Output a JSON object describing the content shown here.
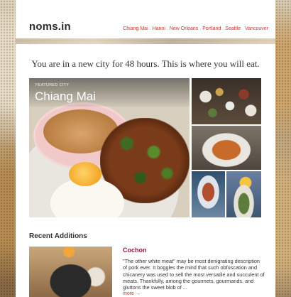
{
  "site": {
    "logo": "noms.in"
  },
  "nav": {
    "items": [
      "Chiang Mai",
      "Hanoi",
      "New Orleans",
      "Portland",
      "Seattle",
      "Vancouver"
    ],
    "separator": "."
  },
  "tagline": "You are in a new city for 48 hours. This is where you will eat.",
  "featured": {
    "label": "FEATURED CITY",
    "city": "Chiang Mai"
  },
  "recent": {
    "heading": "Recent Additions",
    "items": [
      {
        "title": "Cochon",
        "text": "\"The other white meat\" may be most denigrating description of pork ever. It boggles the mind that such obfuscation and chicanery was used to sell the most versatile and succulent of meats. Thankfully, among the gourmets, gourmands, and gluttons the sweet blob of ...",
        "more": "more →"
      }
    ]
  },
  "colors": {
    "accent": "#c0392b",
    "title": "#8b1d3a"
  }
}
